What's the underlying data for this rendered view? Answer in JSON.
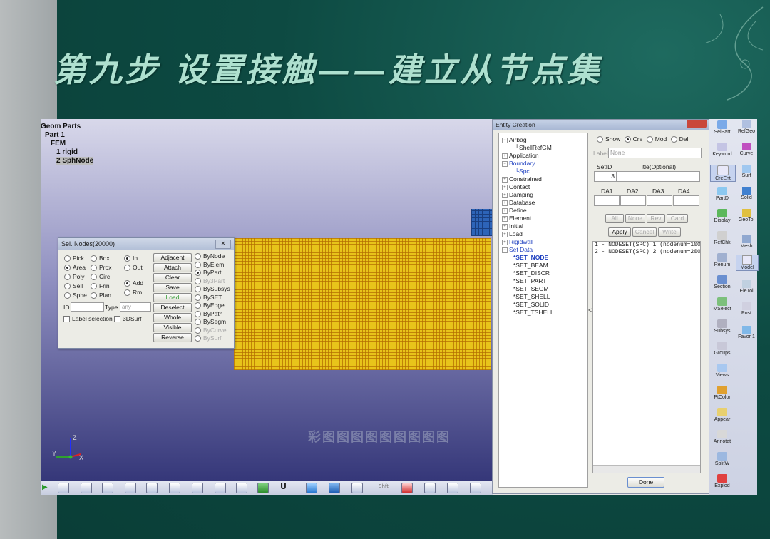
{
  "slide": {
    "title": "第九步 设置接触——建立从节点集"
  },
  "model_tree": {
    "items": [
      "Geom Parts",
      "Part 1",
      "FEM",
      "1 rigid",
      "2 SphNode"
    ]
  },
  "viewport": {
    "watermark": "彩图图图图图图图图图"
  },
  "sel_nodes": {
    "title": "Sel. Nodes(20000)",
    "col1": [
      "Pick",
      "Area",
      "Poly",
      "Sell",
      "Sphe"
    ],
    "col2": [
      "Box",
      "Prox",
      "Circ",
      "Frin",
      "Plan"
    ],
    "col3": [
      "In",
      "Out",
      "Add",
      "Rm"
    ],
    "buttons": [
      "Adjacent",
      "Attach",
      "Clear",
      "Save",
      "Load",
      "Deselect",
      "Whole",
      "Visible",
      "Reverse"
    ],
    "by": [
      "ByNode",
      "ByElem",
      "ByPart",
      "By3Part",
      "BySubsys",
      "BySET",
      "ByEdge",
      "ByPath",
      "BySegm",
      "ByCurve",
      "BySurf"
    ],
    "id_label": "ID",
    "type_label": "Type",
    "type_value": "any",
    "label_selection": "Label selection",
    "surf3d": "3DSurf"
  },
  "entity_creation": {
    "title": "Entity Creation",
    "tree": [
      "Airbag",
      "ShellRefGM",
      "Application",
      "Boundary",
      "Spc",
      "Constrained",
      "Contact",
      "Damping",
      "Database",
      "Define",
      "Element",
      "Initial",
      "Load",
      "Rigidwall",
      "Set Data",
      "*SET_NODE",
      "*SET_BEAM",
      "*SET_DISCR",
      "*SET_PART",
      "*SET_SEGM",
      "*SET_SHELL",
      "*SET_SOLID",
      "*SET_TSHELL"
    ],
    "modes": [
      "Show",
      "Cre",
      "Mod",
      "Del"
    ],
    "label_label": "Label",
    "label_value": "None",
    "setid_label": "SetID",
    "title_label": "Title(Optional)",
    "setid_value": "3",
    "da": [
      "DA1",
      "DA2",
      "DA3",
      "DA4"
    ],
    "buttons_row1": [
      "All",
      "None",
      "Rev",
      "Card"
    ],
    "buttons_row2": [
      "Apply",
      "Cancel",
      "Write"
    ],
    "list": [
      "1 - NODESET(SPC) 1 (nodenum=100",
      "2 - NODESET(SPC) 2 (nodenum=200"
    ],
    "done": "Done",
    "collapse": "<"
  },
  "right_toolbar": {
    "col1": [
      "SelPart",
      "Keyword",
      "CreEnt",
      "PartD",
      "Display",
      "RefChk",
      "Renum",
      "Section",
      "MSelect",
      "Subsys",
      "Groups",
      "Views",
      "PtColor",
      "Appear",
      "Annotat",
      "SplitW",
      "Explod"
    ],
    "col2": [
      "RefGeo",
      "Curve",
      "Surf",
      "Solid",
      "GeoTol",
      "Mesh",
      "Model",
      "EleTol",
      "Post",
      "Favor 1"
    ]
  },
  "bottom_toolbar": {
    "u_label": "U",
    "shift_label": "Shft"
  },
  "axis": {
    "z": "Z",
    "y": "Y",
    "x": "X"
  }
}
